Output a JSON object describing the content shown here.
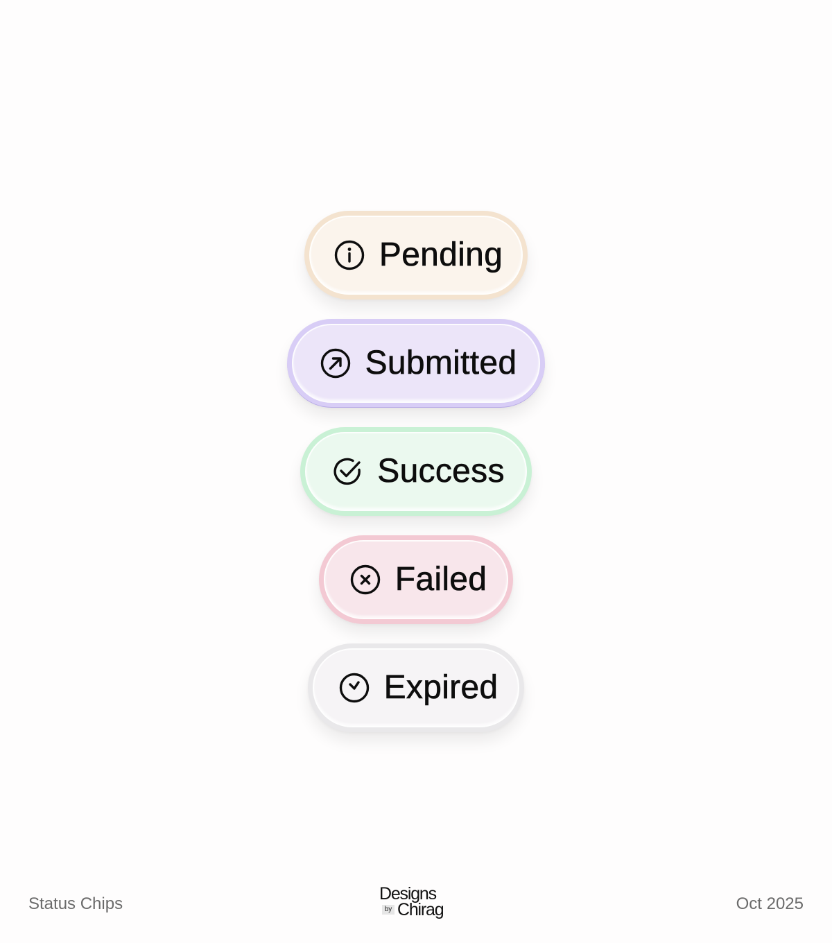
{
  "chips": [
    {
      "key": "pending",
      "label": "Pending",
      "icon": "info-circle-icon",
      "outer_color": "#f4e3cf",
      "inner_color": "#fbf4ec"
    },
    {
      "key": "submitted",
      "label": "Submitted",
      "icon": "arrow-up-right-circle-icon",
      "outer_color": "#d8cdf6",
      "inner_color": "#ece5f9"
    },
    {
      "key": "success",
      "label": "Success",
      "icon": "check-circle-icon",
      "outer_color": "#c9f1d5",
      "inner_color": "#ebf9ef"
    },
    {
      "key": "failed",
      "label": "Failed",
      "icon": "x-circle-icon",
      "outer_color": "#f3c9d3",
      "inner_color": "#f8e6eb"
    },
    {
      "key": "expired",
      "label": "Expired",
      "icon": "clock-icon",
      "outer_color": "#e9e8ea",
      "inner_color": "#f6f4f6"
    }
  ],
  "footer": {
    "left_text": "Status Chips",
    "right_text": "Oct 2025",
    "logo_line1": "Designs",
    "logo_by": "by",
    "logo_line2": "Chirag"
  }
}
